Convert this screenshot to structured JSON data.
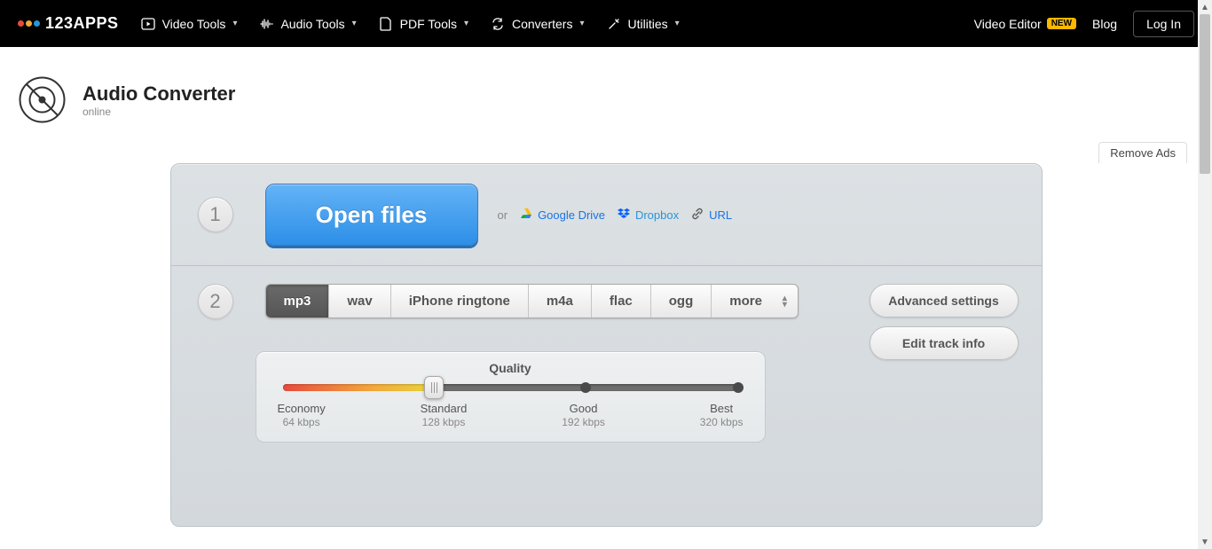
{
  "nav": {
    "logo_text": "123APPS",
    "logo_colors": [
      "#e84a3f",
      "#f4a93c",
      "#2a95d6"
    ],
    "items": [
      {
        "label": "Video Tools"
      },
      {
        "label": "Audio Tools"
      },
      {
        "label": "PDF Tools"
      },
      {
        "label": "Converters"
      },
      {
        "label": "Utilities"
      }
    ],
    "video_editor": "Video Editor",
    "new_badge": "NEW",
    "blog": "Blog",
    "login": "Log In"
  },
  "header": {
    "title": "Audio Converter",
    "subtitle": "online"
  },
  "remove_ads": "Remove Ads",
  "step1": {
    "num": "1",
    "open_files": "Open files",
    "or": "or",
    "google_drive": "Google Drive",
    "dropbox": "Dropbox",
    "url": "URL"
  },
  "step2": {
    "num": "2",
    "formats": [
      "mp3",
      "wav",
      "iPhone ringtone",
      "m4a",
      "flac",
      "ogg",
      "more"
    ],
    "active_format": "mp3"
  },
  "quality": {
    "title": "Quality",
    "levels": [
      {
        "name": "Economy",
        "rate": "64 kbps"
      },
      {
        "name": "Standard",
        "rate": "128 kbps"
      },
      {
        "name": "Good",
        "rate": "192 kbps"
      },
      {
        "name": "Best",
        "rate": "320 kbps"
      }
    ],
    "selected_index": 1
  },
  "side": {
    "advanced": "Advanced settings",
    "edit_track": "Edit track info"
  }
}
